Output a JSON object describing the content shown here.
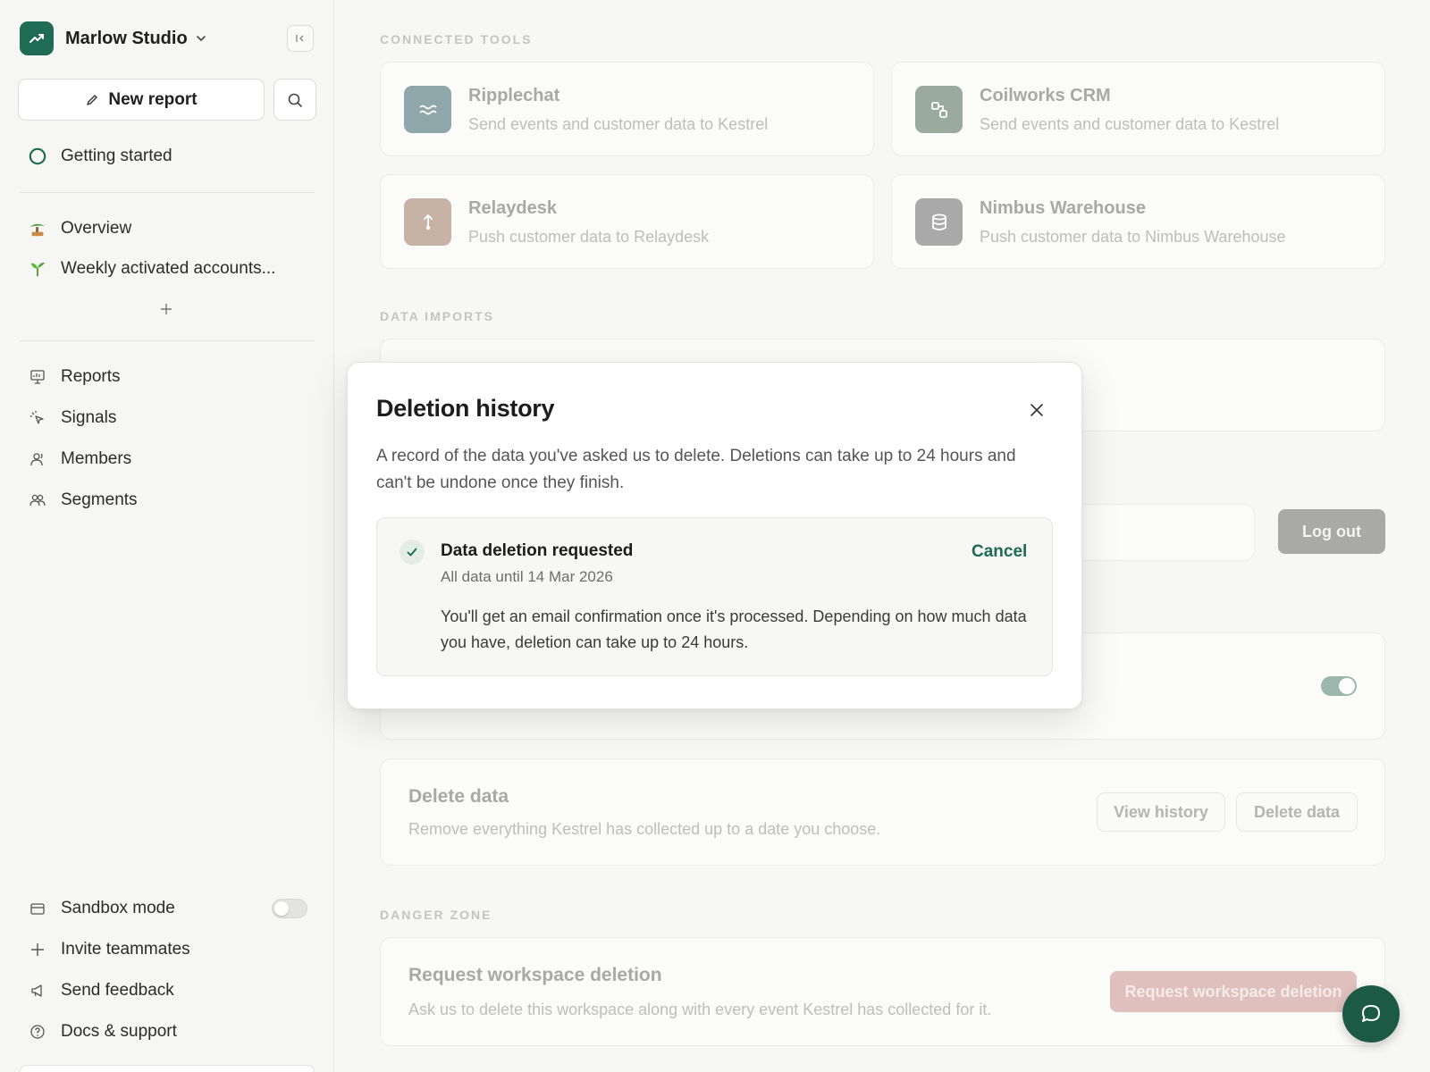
{
  "sidebar": {
    "workspace_name": "Marlow Studio",
    "new_report_label": "New report",
    "getting_started_label": "Getting started",
    "pinned": [
      {
        "label": "Overview",
        "icon": "palm-tree-emoji-icon"
      },
      {
        "label": "Weekly activated accounts...",
        "icon": "seedling-emoji-icon"
      }
    ],
    "nav": [
      {
        "label": "Reports",
        "icon": "presentation-icon"
      },
      {
        "label": "Signals",
        "icon": "cursor-click-icon"
      },
      {
        "label": "Members",
        "icon": "user-icon"
      },
      {
        "label": "Segments",
        "icon": "users-icon"
      }
    ],
    "bottom": [
      {
        "label": "Sandbox mode",
        "icon": "card-icon"
      },
      {
        "label": "Invite teammates",
        "icon": "plus-icon"
      },
      {
        "label": "Send feedback",
        "icon": "megaphone-icon"
      },
      {
        "label": "Docs & support",
        "icon": "help-circle-icon"
      }
    ],
    "sandbox_enabled": false
  },
  "main": {
    "connected_tools_label": "CONNECTED TOOLS",
    "tools": [
      {
        "name": "Ripplechat",
        "desc": "Send events and customer data to Kestrel",
        "icon": "waves-icon",
        "color": "#8fa7ab"
      },
      {
        "name": "Coilworks CRM",
        "desc": "Send events and customer data to Kestrel",
        "icon": "nodes-icon",
        "color": "#9aaa9f"
      },
      {
        "name": "Relaydesk",
        "desc": "Push customer data to Relaydesk",
        "icon": "upload-pin-icon",
        "color": "#c7b2a6"
      },
      {
        "name": "Nimbus Warehouse",
        "desc": "Push customer data to Nimbus Warehouse",
        "icon": "database-icon",
        "color": "#a9a9a9"
      }
    ],
    "data_imports_label": "DATA IMPORTS",
    "logout_label": "Log out",
    "tracking_enabled": true,
    "delete_data": {
      "title": "Delete data",
      "desc": "Remove everything Kestrel has collected up to a date you choose.",
      "view_history_label": "View history",
      "delete_label": "Delete data"
    },
    "danger_zone_label": "DANGER ZONE",
    "workspace_deletion": {
      "title": "Request workspace deletion",
      "desc": "Ask us to delete this workspace along with every event Kestrel has collected for it.",
      "button_label": "Request workspace deletion"
    }
  },
  "modal": {
    "title": "Deletion history",
    "desc": "A record of the data you've asked us to delete. Deletions can take up to 24 hours and can't be undone once they finish.",
    "entry": {
      "title": "Data deletion requested",
      "subtitle": "All data until 14 Mar 2026",
      "body": "You'll get an email confirmation once it's processed. Depending on how much data you have, deletion can take up to 24 hours.",
      "cancel_label": "Cancel"
    }
  },
  "colors": {
    "brand": "#1f6b53",
    "accent_text": "#1e6a52",
    "danger": "#dfc0bd"
  }
}
